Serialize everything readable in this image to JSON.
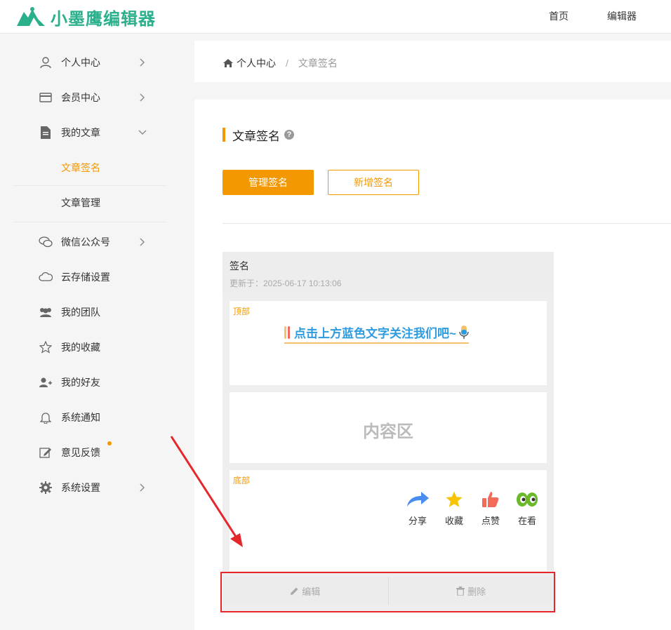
{
  "header": {
    "logo_text": "小墨鹰编辑器",
    "nav": [
      "首页",
      "编辑器"
    ]
  },
  "sidebar": {
    "items": [
      {
        "label": "个人中心",
        "icon": "user-icon"
      },
      {
        "label": "会员中心",
        "icon": "card-icon"
      },
      {
        "label": "我的文章",
        "icon": "document-icon"
      },
      {
        "label": "文章签名",
        "icon": ""
      },
      {
        "label": "文章管理",
        "icon": ""
      },
      {
        "label": "微信公众号",
        "icon": "wechat-icon"
      },
      {
        "label": "云存储设置",
        "icon": "cloud-icon"
      },
      {
        "label": "我的团队",
        "icon": "team-icon"
      },
      {
        "label": "我的收藏",
        "icon": "star-icon"
      },
      {
        "label": "我的好友",
        "icon": "add-friend-icon"
      },
      {
        "label": "系统通知",
        "icon": "bell-icon"
      },
      {
        "label": "意见反馈",
        "icon": "feedback-icon"
      },
      {
        "label": "系统设置",
        "icon": "gear-icon"
      }
    ]
  },
  "breadcrumb": {
    "home": "个人中心",
    "separator": "/",
    "current": "文章签名"
  },
  "main": {
    "title": "文章签名",
    "help": "?",
    "manage_button": "管理签名",
    "add_button": "新增签名"
  },
  "signature": {
    "name": "签名",
    "updated": "更新于：2025-06-17 10:13:06",
    "top_label": "顶部",
    "follow_text": "点击上方蓝色文字关注我们吧~",
    "content_text": "内容区",
    "bottom_label": "底部",
    "actions": [
      "分享",
      "收藏",
      "点赞",
      "在看"
    ],
    "edit_button": "编辑",
    "delete_button": "删除"
  },
  "colors": {
    "accent": "#f39800",
    "brand": "#2bb08c",
    "annotation": "#e5262a",
    "link_blue": "#2e9be0"
  }
}
